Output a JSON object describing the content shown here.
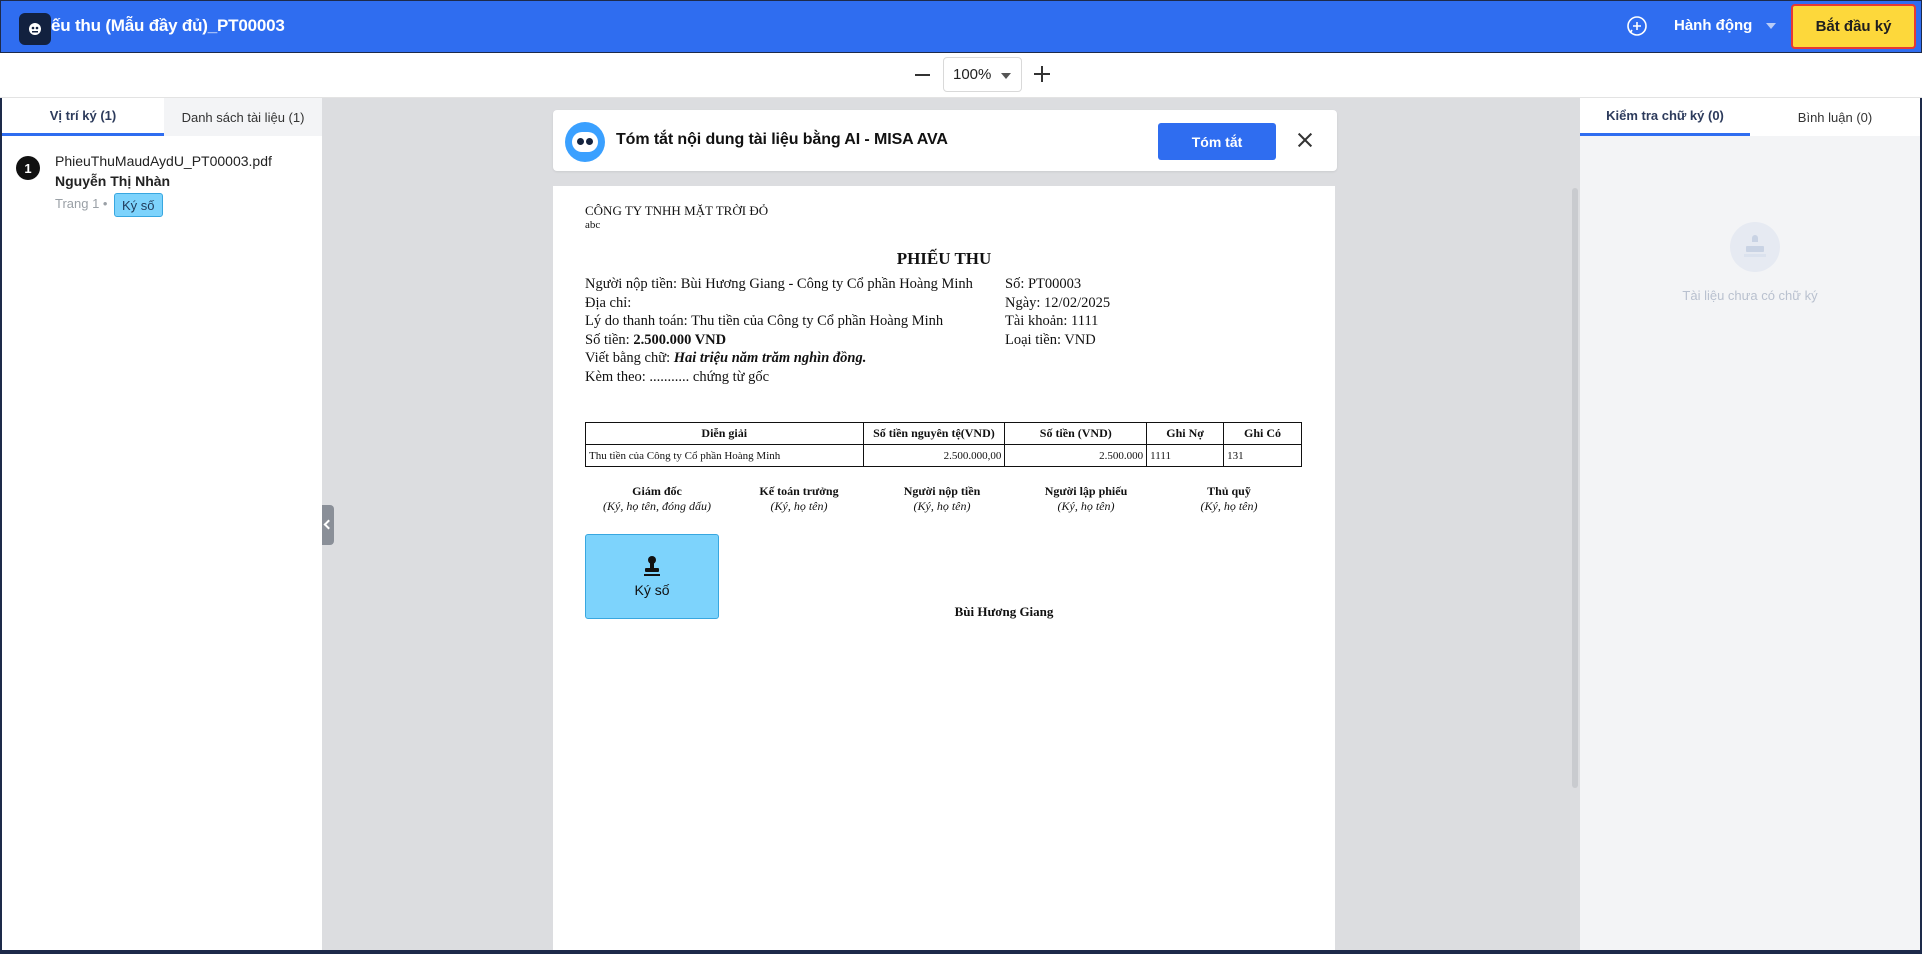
{
  "header": {
    "title": "ếu thu (Mẫu đầy đủ)_PT00003",
    "actions_label": "Hành động",
    "start_sign_label": "Bắt đầu ký"
  },
  "zoom": {
    "value": "100%"
  },
  "left_panel": {
    "tabs": [
      {
        "label": "Vị trí ký (1)",
        "active": true
      },
      {
        "label": "Danh sách tài liệu (1)",
        "active": false
      }
    ],
    "signatures": [
      {
        "number": "1",
        "file": "PhieuThuMaudAydU_PT00003.pdf",
        "signer": "Nguyễn Thị Nhàn",
        "page": "Trang 1 •",
        "type_badge": "Ký số"
      }
    ]
  },
  "ai_bar": {
    "text": "Tóm tắt nội dung tài liệu bằng AI - MISA AVA",
    "button_label": "Tóm tắt"
  },
  "document": {
    "company": "CÔNG TY TNHH MẶT TRỜI ĐỎ",
    "company_sub": "abc",
    "title": "PHIẾU THU",
    "payer_label": "Người nộp tiền: ",
    "payer_value": "Bùi Hương Giang - Công ty Cổ phần Hoàng Minh",
    "address_label": "Địa chỉ:",
    "reason_label": "Lý do thanh toán: ",
    "reason_value": "Thu tiền của Công ty Cổ phần Hoàng Minh",
    "amount_label": "Số tiền: ",
    "amount_value": "2.500.000 VND",
    "words_label": "Viết bằng chữ: ",
    "words_value": "Hai triệu năm trăm nghìn đồng.",
    "attach_label": "Kèm theo: ........... chứng từ gốc",
    "number_label": "Số: PT00003",
    "date_label": "Ngày: 12/02/2025",
    "account_label": "Tài khoản: 1111",
    "currency_label": "Loại tiền: VND",
    "table": {
      "headers": [
        "Diễn giải",
        "Số tiền nguyên tệ(VND)",
        "Số tiền (VND)",
        "Ghi Nợ",
        "Ghi Có"
      ],
      "rows": [
        [
          "Thu tiền của Công ty Cổ phần Hoàng Minh",
          "2.500.000,00",
          "2.500.000",
          "1111",
          "131"
        ]
      ]
    },
    "signatories": [
      {
        "title": "Giám đốc",
        "sub": "(Ký, họ tên, đóng dấu)"
      },
      {
        "title": "Kế toán trưởng",
        "sub": "(Ký, họ tên)"
      },
      {
        "title": "Người nộp tiền",
        "sub": "(Ký, họ tên)"
      },
      {
        "title": "Người lập phiếu",
        "sub": "(Ký, họ tên)"
      },
      {
        "title": "Thủ quỹ",
        "sub": "(Ký, họ tên)"
      }
    ],
    "sign_box_label": "Ký số",
    "signer_name": "Bùi Hương Giang"
  },
  "right_panel": {
    "tabs": [
      {
        "label": "Kiểm tra chữ ký (0)",
        "active": true
      },
      {
        "label": "Bình luận (0)",
        "active": false
      }
    ],
    "empty_text": "Tài liệu chưa có chữ ký"
  },
  "colors": {
    "header_bg": "#2f6df0",
    "primary_button": "#2f6df0",
    "start_button": "#fdd83b",
    "sign_badge": "#7dd3fc"
  }
}
